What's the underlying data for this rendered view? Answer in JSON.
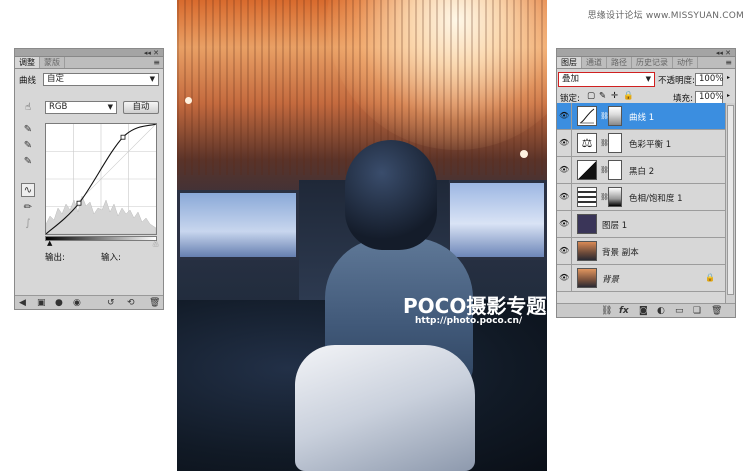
{
  "watermark": "思缘设计论坛 www.MISSYUAN.COM",
  "photo": {
    "logo_text": "POCO摄影专题",
    "logo_url": "http://photo.poco.cn/"
  },
  "adjustments_panel": {
    "topbar_buttons": "◂◂ ✕",
    "tabs": [
      {
        "label": "调整",
        "active": true
      },
      {
        "label": "蒙版",
        "active": false
      }
    ],
    "menu_icon": "≡",
    "preset_label": "曲线",
    "preset_value": "自定",
    "channel_value": "RGB",
    "auto_button": "自动",
    "output_label": "输出:",
    "input_label": "输入:",
    "curve_points": [
      [
        0,
        0
      ],
      [
        0.3,
        0.28
      ],
      [
        0.7,
        0.88
      ],
      [
        1,
        1
      ]
    ]
  },
  "layers_panel": {
    "topbar_buttons": "◂◂ ✕",
    "tabs": [
      {
        "label": "图层",
        "active": true
      },
      {
        "label": "通道",
        "active": false
      },
      {
        "label": "路径",
        "active": false
      },
      {
        "label": "历史记录",
        "active": false
      },
      {
        "label": "动作",
        "active": false
      }
    ],
    "menu_icon": "≡",
    "blend_mode": "叠加",
    "opacity_label": "不透明度:",
    "opacity_value": "100%",
    "lock_label": "锁定:",
    "fill_label": "填充:",
    "fill_value": "100%",
    "layers": [
      {
        "name": "曲线 1",
        "kind": "adjustment-curves",
        "selected": true
      },
      {
        "name": "色彩平衡 1",
        "kind": "adjustment-color-balance",
        "selected": false
      },
      {
        "name": "黑白 2",
        "kind": "adjustment-black-white",
        "selected": false
      },
      {
        "name": "色相/饱和度 1",
        "kind": "adjustment-hue-saturation",
        "selected": false
      },
      {
        "name": "图层 1",
        "kind": "solid-fill",
        "selected": false
      },
      {
        "name": "背景 副本",
        "kind": "photo",
        "selected": false
      },
      {
        "name": "背景",
        "kind": "photo-locked",
        "selected": false
      }
    ],
    "colors": {
      "selected_row": "#3b8ee0",
      "solid_fill": "#3a3558",
      "blend_box_border": "#d02020"
    }
  }
}
